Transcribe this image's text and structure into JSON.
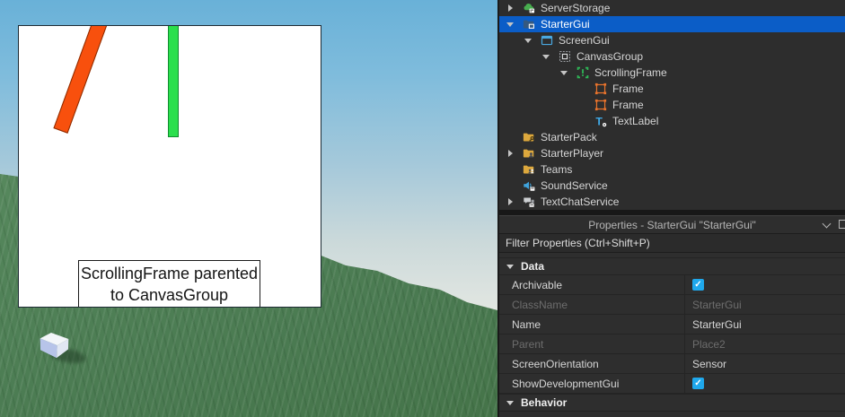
{
  "viewport": {
    "caption_line1": "ScrollingFrame parented",
    "caption_line2": "to CanvasGroup",
    "bars": [
      {
        "name": "rotated-frame",
        "color": "#f8500d",
        "border": "#8a2b00"
      },
      {
        "name": "vertical-frame",
        "color": "#2bdf4d",
        "border": "#0f8c2e"
      }
    ]
  },
  "explorer": {
    "selection_color": "#0b5dc7",
    "items": [
      {
        "label": "ServerStorage",
        "icon": "server-storage-icon",
        "level": 0,
        "expand": "closed"
      },
      {
        "label": "StarterGui",
        "icon": "starter-gui-icon",
        "level": 0,
        "expand": "open",
        "selected": true
      },
      {
        "label": "ScreenGui",
        "icon": "screen-gui-icon",
        "level": 1,
        "expand": "open"
      },
      {
        "label": "CanvasGroup",
        "icon": "canvas-group-icon",
        "level": 2,
        "expand": "open"
      },
      {
        "label": "ScrollingFrame",
        "icon": "scrolling-frame-icon",
        "level": 3,
        "expand": "open"
      },
      {
        "label": "Frame",
        "icon": "frame-icon",
        "level": 4
      },
      {
        "label": "Frame",
        "icon": "frame-icon",
        "level": 4
      },
      {
        "label": "TextLabel",
        "icon": "text-label-icon",
        "level": 4
      },
      {
        "label": "StarterPack",
        "icon": "starter-pack-icon",
        "level": 0
      },
      {
        "label": "StarterPlayer",
        "icon": "starter-player-icon",
        "level": 0,
        "expand": "closed"
      },
      {
        "label": "Teams",
        "icon": "teams-icon",
        "level": 0
      },
      {
        "label": "SoundService",
        "icon": "sound-service-icon",
        "level": 0
      },
      {
        "label": "TextChatService",
        "icon": "text-chat-service-icon",
        "level": 0,
        "expand": "closed"
      }
    ]
  },
  "properties": {
    "title": "Properties - StarterGui \"StarterGui\"",
    "filter_placeholder": "Filter Properties (Ctrl+Shift+P)",
    "checkbox_color": "#1fa8ec",
    "sections": [
      {
        "label": "Data",
        "rows": [
          {
            "name": "Archivable",
            "type": "checkbox",
            "checked": true
          },
          {
            "name": "ClassName",
            "value": "StarterGui",
            "disabled": true
          },
          {
            "name": "Name",
            "value": "StarterGui"
          },
          {
            "name": "Parent",
            "value": "Place2",
            "disabled": true
          },
          {
            "name": "ScreenOrientation",
            "value": "Sensor"
          },
          {
            "name": "ShowDevelopmentGui",
            "type": "checkbox",
            "checked": true
          }
        ]
      },
      {
        "label": "Behavior",
        "rows": []
      }
    ]
  }
}
